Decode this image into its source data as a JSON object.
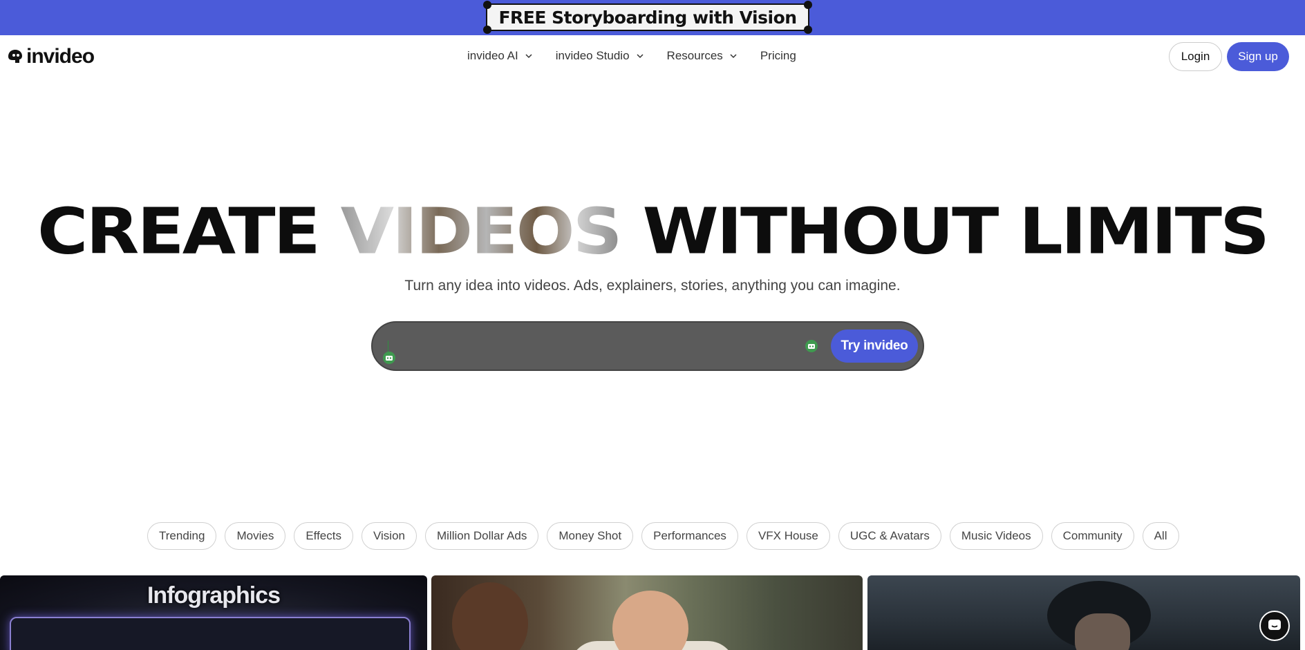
{
  "promo": {
    "text": "FREE Storyboarding with Vision"
  },
  "brand": {
    "name": "invideo"
  },
  "nav": {
    "links": [
      {
        "label": "invideo AI",
        "has_dropdown": true
      },
      {
        "label": "invideo Studio",
        "has_dropdown": true
      },
      {
        "label": "Resources",
        "has_dropdown": true
      },
      {
        "label": "Pricing",
        "has_dropdown": false
      }
    ],
    "login": "Login",
    "signup": "Sign up"
  },
  "hero": {
    "title_pre": "CREATE ",
    "title_media": "VIDEOS",
    "title_post": " WITHOUT LIMITS",
    "subtitle": "Turn any idea into videos. Ads, explainers, stories, anything you can imagine."
  },
  "prompt": {
    "value": "",
    "cta": "Try invideo"
  },
  "categories": [
    "Trending",
    "Movies",
    "Effects",
    "Vision",
    "Million Dollar Ads",
    "Money Shot",
    "Performances",
    "VFX House",
    "UGC & Avatars",
    "Music Videos",
    "Community",
    "All"
  ],
  "thumbnails": {
    "first_title": "Infographics"
  },
  "colors": {
    "accent": "#4b5bd9",
    "prompt_bg": "#5b5b5b",
    "text": "#111111"
  },
  "icons": {
    "logo": "invideo-logo-icon",
    "dropdown": "chevron-down-icon",
    "assistant": "bot-icon",
    "chat": "chat-icon"
  }
}
